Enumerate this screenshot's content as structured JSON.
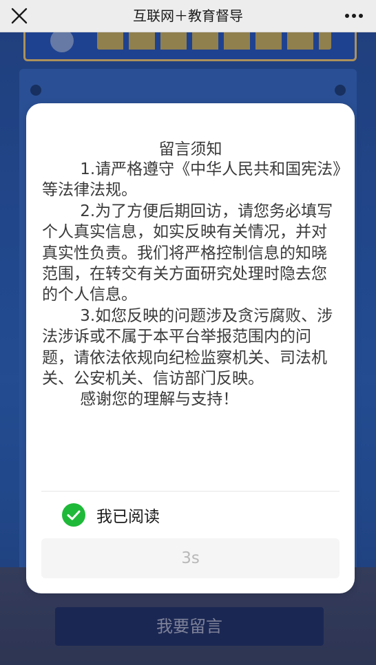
{
  "nav": {
    "title": "互联网＋教育督导"
  },
  "notice": {
    "title": "留言须知",
    "paragraphs": [
      "1.请严格遵守《中华人民共和国宪法》等法律法规。",
      "2.为了方便后期回访，请您务必填写个人真实信息，如实反映有关情况，并对真实性负责。我们将严格控制信息的知晓范围，在转交有关方面研究处理时隐去您的个人信息。",
      "3.如您反映的问题涉及贪污腐败、涉法涉诉或不属于本平台举报范围内的问题，请依法依规向纪检监察机关、司法机关、公安机关、信访部门反映。",
      "感谢您的理解与支持！"
    ],
    "read_label": "我已阅读",
    "read_checked": true,
    "countdown_label": "3s"
  },
  "background": {
    "leave_message_button": "我要留言"
  },
  "colors": {
    "check_green": "#1fb939",
    "navbar": "#ededed"
  },
  "icons": {
    "close": "close-icon",
    "more": "more-icon",
    "check": "check-circle-icon"
  }
}
